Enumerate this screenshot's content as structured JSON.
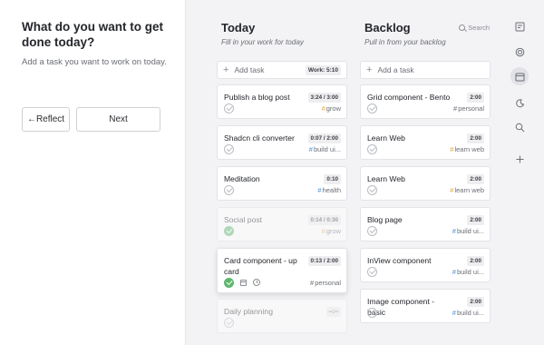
{
  "left": {
    "title": "What do you want to get done today?",
    "subtitle": "Add a task you want to work on today.",
    "reflect_label": "←Reflect",
    "next_label": "Next"
  },
  "today": {
    "title": "Today",
    "subtitle": "Fill in your work for today",
    "add_label": "Add task",
    "work_badge": "Work: 5:10",
    "cards": [
      {
        "title": "Publish a blog post",
        "time": "3:24 / 3:00",
        "tag": "grow",
        "tag_color": "#e8a838",
        "done": false,
        "faded": false
      },
      {
        "title": "Shadcn cli converter",
        "time": "0:07 / 2:00",
        "tag": "build ui...",
        "tag_color": "#4a90d9",
        "done": false,
        "faded": false
      },
      {
        "title": "Meditation",
        "time": "0:10",
        "tag": "health",
        "tag_color": "#4a90d9",
        "done": false,
        "faded": false
      },
      {
        "title": "Social post",
        "time": "0:14 / 0:30",
        "tag": "grow",
        "tag_color": "#e8a838",
        "done": true,
        "faded": true
      },
      {
        "title": "Card component - up card",
        "time": "0:13 / 2:00",
        "tag": "personal",
        "tag_color": "#6b6e75",
        "done": true,
        "faded": false
      },
      {
        "title": "Daily planning",
        "time": "--:--",
        "tag": "",
        "tag_color": "#6b6e75",
        "done": false,
        "faded": true
      }
    ]
  },
  "backlog": {
    "title": "Backlog",
    "subtitle": "Pull in from your backlog",
    "search_label": "Search",
    "add_label": "Add a task",
    "cards": [
      {
        "title": "Grid component - Bento",
        "time": "2:00",
        "tag": "personal",
        "tag_color": "#6b6e75"
      },
      {
        "title": "Learn Web",
        "time": "2:00",
        "tag": "learn web",
        "tag_color": "#e8a838"
      },
      {
        "title": "Learn Web",
        "time": "2:00",
        "tag": "learn web",
        "tag_color": "#e8a838"
      },
      {
        "title": "Blog page",
        "time": "2:00",
        "tag": "build ui...",
        "tag_color": "#4a90d9"
      },
      {
        "title": "InView component",
        "time": "2:00",
        "tag": "build ui...",
        "tag_color": "#4a90d9"
      },
      {
        "title": "Image component - basic",
        "time": "2:00",
        "tag": "build ui...",
        "tag_color": "#4a90d9"
      }
    ]
  },
  "rail": {
    "icons": [
      "notes-icon",
      "target-icon",
      "calendar-icon",
      "moon-icon",
      "search-icon",
      "plus-icon"
    ]
  }
}
